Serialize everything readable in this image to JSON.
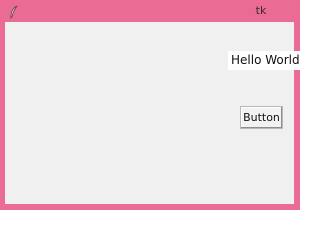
{
  "window": {
    "title": "tk",
    "icon": "feather-icon",
    "frame_color": "#ea6b94",
    "client_color": "#f0f0f0"
  },
  "content": {
    "label_text": "Hello World",
    "button_label": "Button"
  }
}
